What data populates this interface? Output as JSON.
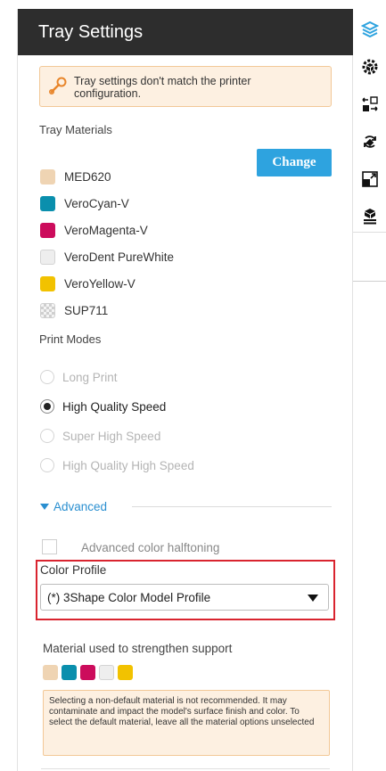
{
  "panel": {
    "title": "Tray Settings"
  },
  "warning": {
    "text": "Tray settings don't match the printer configuration.",
    "icon": "wrench-icon"
  },
  "tray_materials": {
    "label": "Tray Materials",
    "change_label": "Change",
    "items": [
      {
        "name": "MED620",
        "color": "#efd4b3"
      },
      {
        "name": "VeroCyan-V",
        "color": "#0a8fad"
      },
      {
        "name": "VeroMagenta-V",
        "color": "#cc0c5c"
      },
      {
        "name": "VeroDent PureWhite",
        "color": "#eeeeee"
      },
      {
        "name": "VeroYellow-V",
        "color": "#f2c200"
      },
      {
        "name": "SUP711",
        "color": "checker"
      }
    ]
  },
  "print_modes": {
    "label": "Print Modes",
    "options": [
      {
        "label": "Long Print",
        "selected": false,
        "enabled": false
      },
      {
        "label": "High Quality Speed",
        "selected": true,
        "enabled": true
      },
      {
        "label": "Super High Speed",
        "selected": false,
        "enabled": false
      },
      {
        "label": "High Quality High Speed",
        "selected": false,
        "enabled": false
      }
    ]
  },
  "advanced": {
    "label": "Advanced",
    "expanded": true,
    "halftoning_label": "Advanced color halftoning",
    "halftoning_checked": false
  },
  "color_profile": {
    "label": "Color Profile",
    "value": "(*) 3Shape Color Model Profile"
  },
  "support": {
    "label": "Material used to strengthen support",
    "swatches": [
      "#efd4b3",
      "#0a8fad",
      "#cc0c5c",
      "#eeeeee",
      "#f2c200"
    ],
    "note": "Selecting a non-default material is not recommended. It may contaminate and impact the model's surface finish and color. To select the default material, leave all the material options unselected"
  },
  "toolbar": {
    "items": [
      "layers-icon",
      "cube-gear-icon",
      "arrange-icon",
      "rotate-icon",
      "scale-icon",
      "tray-stack-icon"
    ]
  },
  "colors": {
    "header_bg": "#2d2d2d",
    "accent": "#2ea3df",
    "warning_bg": "#fdf0e1",
    "highlight_border": "#d9242f"
  }
}
